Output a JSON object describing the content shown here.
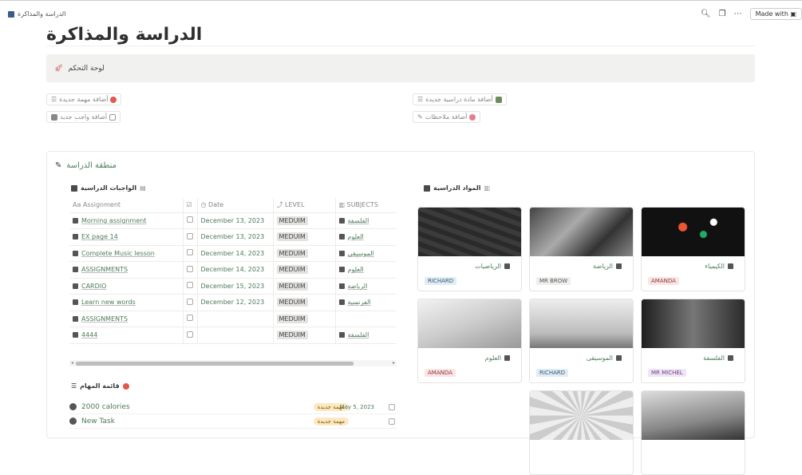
{
  "topbar": {
    "breadcrumb": "الدراسة والمذاكرة",
    "search_icon": "search-icon",
    "made_with": "Made with"
  },
  "page": {
    "title": "الدراسة والمذاكرة"
  },
  "callout": {
    "text": "لوحة التحكم"
  },
  "buttons": {
    "new_task": "أضافة مهمة جديدة",
    "new_homework": "أضافة واجب جديد",
    "new_subject": "أضافة مادة دراسية جديدة",
    "new_notes": "أضافة ملاحظات"
  },
  "study_area": {
    "title": "منطقة الدراسة"
  },
  "homework": {
    "heading": "الواجبات الدراسية",
    "columns": [
      "Assignment",
      "",
      "Date",
      "LEVEL",
      "SUBJECTS"
    ],
    "rows": [
      {
        "name": "Morning assignment",
        "date": "December 13, 2023",
        "level": "MEDUIM",
        "subject": "الفلسفة"
      },
      {
        "name": "EX page 14",
        "date": "December 13, 2023",
        "level": "MEDUIM",
        "subject": "العلوم"
      },
      {
        "name": "Complete Music lesson",
        "date": "December 14, 2023",
        "level": "MEDUIM",
        "subject": "الموسيقى"
      },
      {
        "name": "ASSIGNMENTS",
        "date": "December 14, 2023",
        "level": "MEDUIM",
        "subject": "العلوم"
      },
      {
        "name": "CARDIO",
        "date": "December 15, 2023",
        "level": "MEDUIM",
        "subject": "الرياضة"
      },
      {
        "name": "Learn new words",
        "date": "December 12, 2023",
        "level": "MEDUIM",
        "subject": "الفرنسية"
      },
      {
        "name": "ASSIGNMENTS",
        "date": "",
        "level": "MEDUIM",
        "subject": ""
      },
      {
        "name": "4444",
        "date": "",
        "level": "MEDUIM",
        "subject": "الفلسفة"
      }
    ]
  },
  "tasks": {
    "heading": "قائمة المهام",
    "items": [
      {
        "name": "2000 calories",
        "badge": "مهمة جديدة",
        "date": "May 5, 2023"
      },
      {
        "name": "New Task",
        "badge": "مهمة جديدة",
        "date": ""
      }
    ]
  },
  "subjects": {
    "heading": "المواد الدراسية",
    "cards": [
      {
        "name": "الكيمياء",
        "tag": "AMANDA",
        "tag_color": "#fbe4e4",
        "tag_text": "#8a3a3a"
      },
      {
        "name": "الرياضة",
        "tag": "MR BROW",
        "tag_color": "#eeeeec",
        "tag_text": "#555"
      },
      {
        "name": "الرياضيات",
        "tag": "RICHARD",
        "tag_color": "#e1ecf4",
        "tag_text": "#2f5b7a"
      },
      {
        "name": "الفلسفة",
        "tag": "MR MICHEL",
        "tag_color": "#efe6f5",
        "tag_text": "#6a3b85"
      },
      {
        "name": "الموسيقى",
        "tag": "RICHARD",
        "tag_color": "#e1ecf4",
        "tag_text": "#2f5b7a"
      },
      {
        "name": "العلوم",
        "tag": "AMANDA",
        "tag_color": "#fbe4e4",
        "tag_text": "#8a3a3a"
      },
      {
        "name": "",
        "tag": "",
        "tag_color": "#fff",
        "tag_text": "#fff"
      },
      {
        "name": "",
        "tag": "",
        "tag_color": "#fff",
        "tag_text": "#fff"
      }
    ]
  }
}
